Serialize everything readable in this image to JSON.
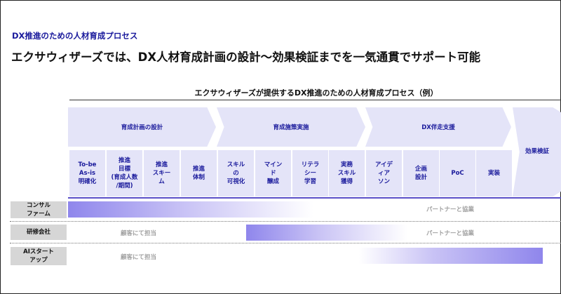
{
  "header": {
    "subtitle": "DX推進のための人材育成プロセス",
    "headline": "エクサウィザーズでは、DX人材育成計画の設計〜効果検証までを一気通貫でサポート可能"
  },
  "diagram": {
    "title": "エクサウィザーズが提供するDX推進のための人材育成プロセス（例）",
    "phases": [
      {
        "label": "育成計画の設計"
      },
      {
        "label": "育成施策実施"
      },
      {
        "label": "DX伴走支援"
      },
      {
        "label": "効果検証"
      }
    ],
    "steps": [
      {
        "label": "To-be\nAs-is\n明確化"
      },
      {
        "label": "推進\n目標\n(育成人数\n/期間)"
      },
      {
        "label": "推進\nスキー\nム"
      },
      {
        "label": "推進\n体制"
      },
      {
        "label": "スキル\nの\n可視化"
      },
      {
        "label": "マイン\nド\n醸成"
      },
      {
        "label": "リテラ\nシー\n学習"
      },
      {
        "label": "実務\nスキル\n獲得"
      },
      {
        "label": "アイデ\nィア\nソン"
      },
      {
        "label": "企画\n設計"
      },
      {
        "label": "PoC"
      },
      {
        "label": "実装"
      }
    ],
    "rows": [
      {
        "label": "コンサル\nファーム",
        "note": "パートナーと協業"
      },
      {
        "label": "研修会社",
        "note_left": "顧客にて担当",
        "note_right": "パートナーと協業"
      },
      {
        "label": "AIスタート\nアップ",
        "note_left": "顧客にて担当"
      }
    ]
  },
  "colors": {
    "accent": "#1a1a9c",
    "phase_fill": "#e4e4f8",
    "bar_fill": "#8f86ec",
    "label_bg": "#d6d6d6"
  }
}
